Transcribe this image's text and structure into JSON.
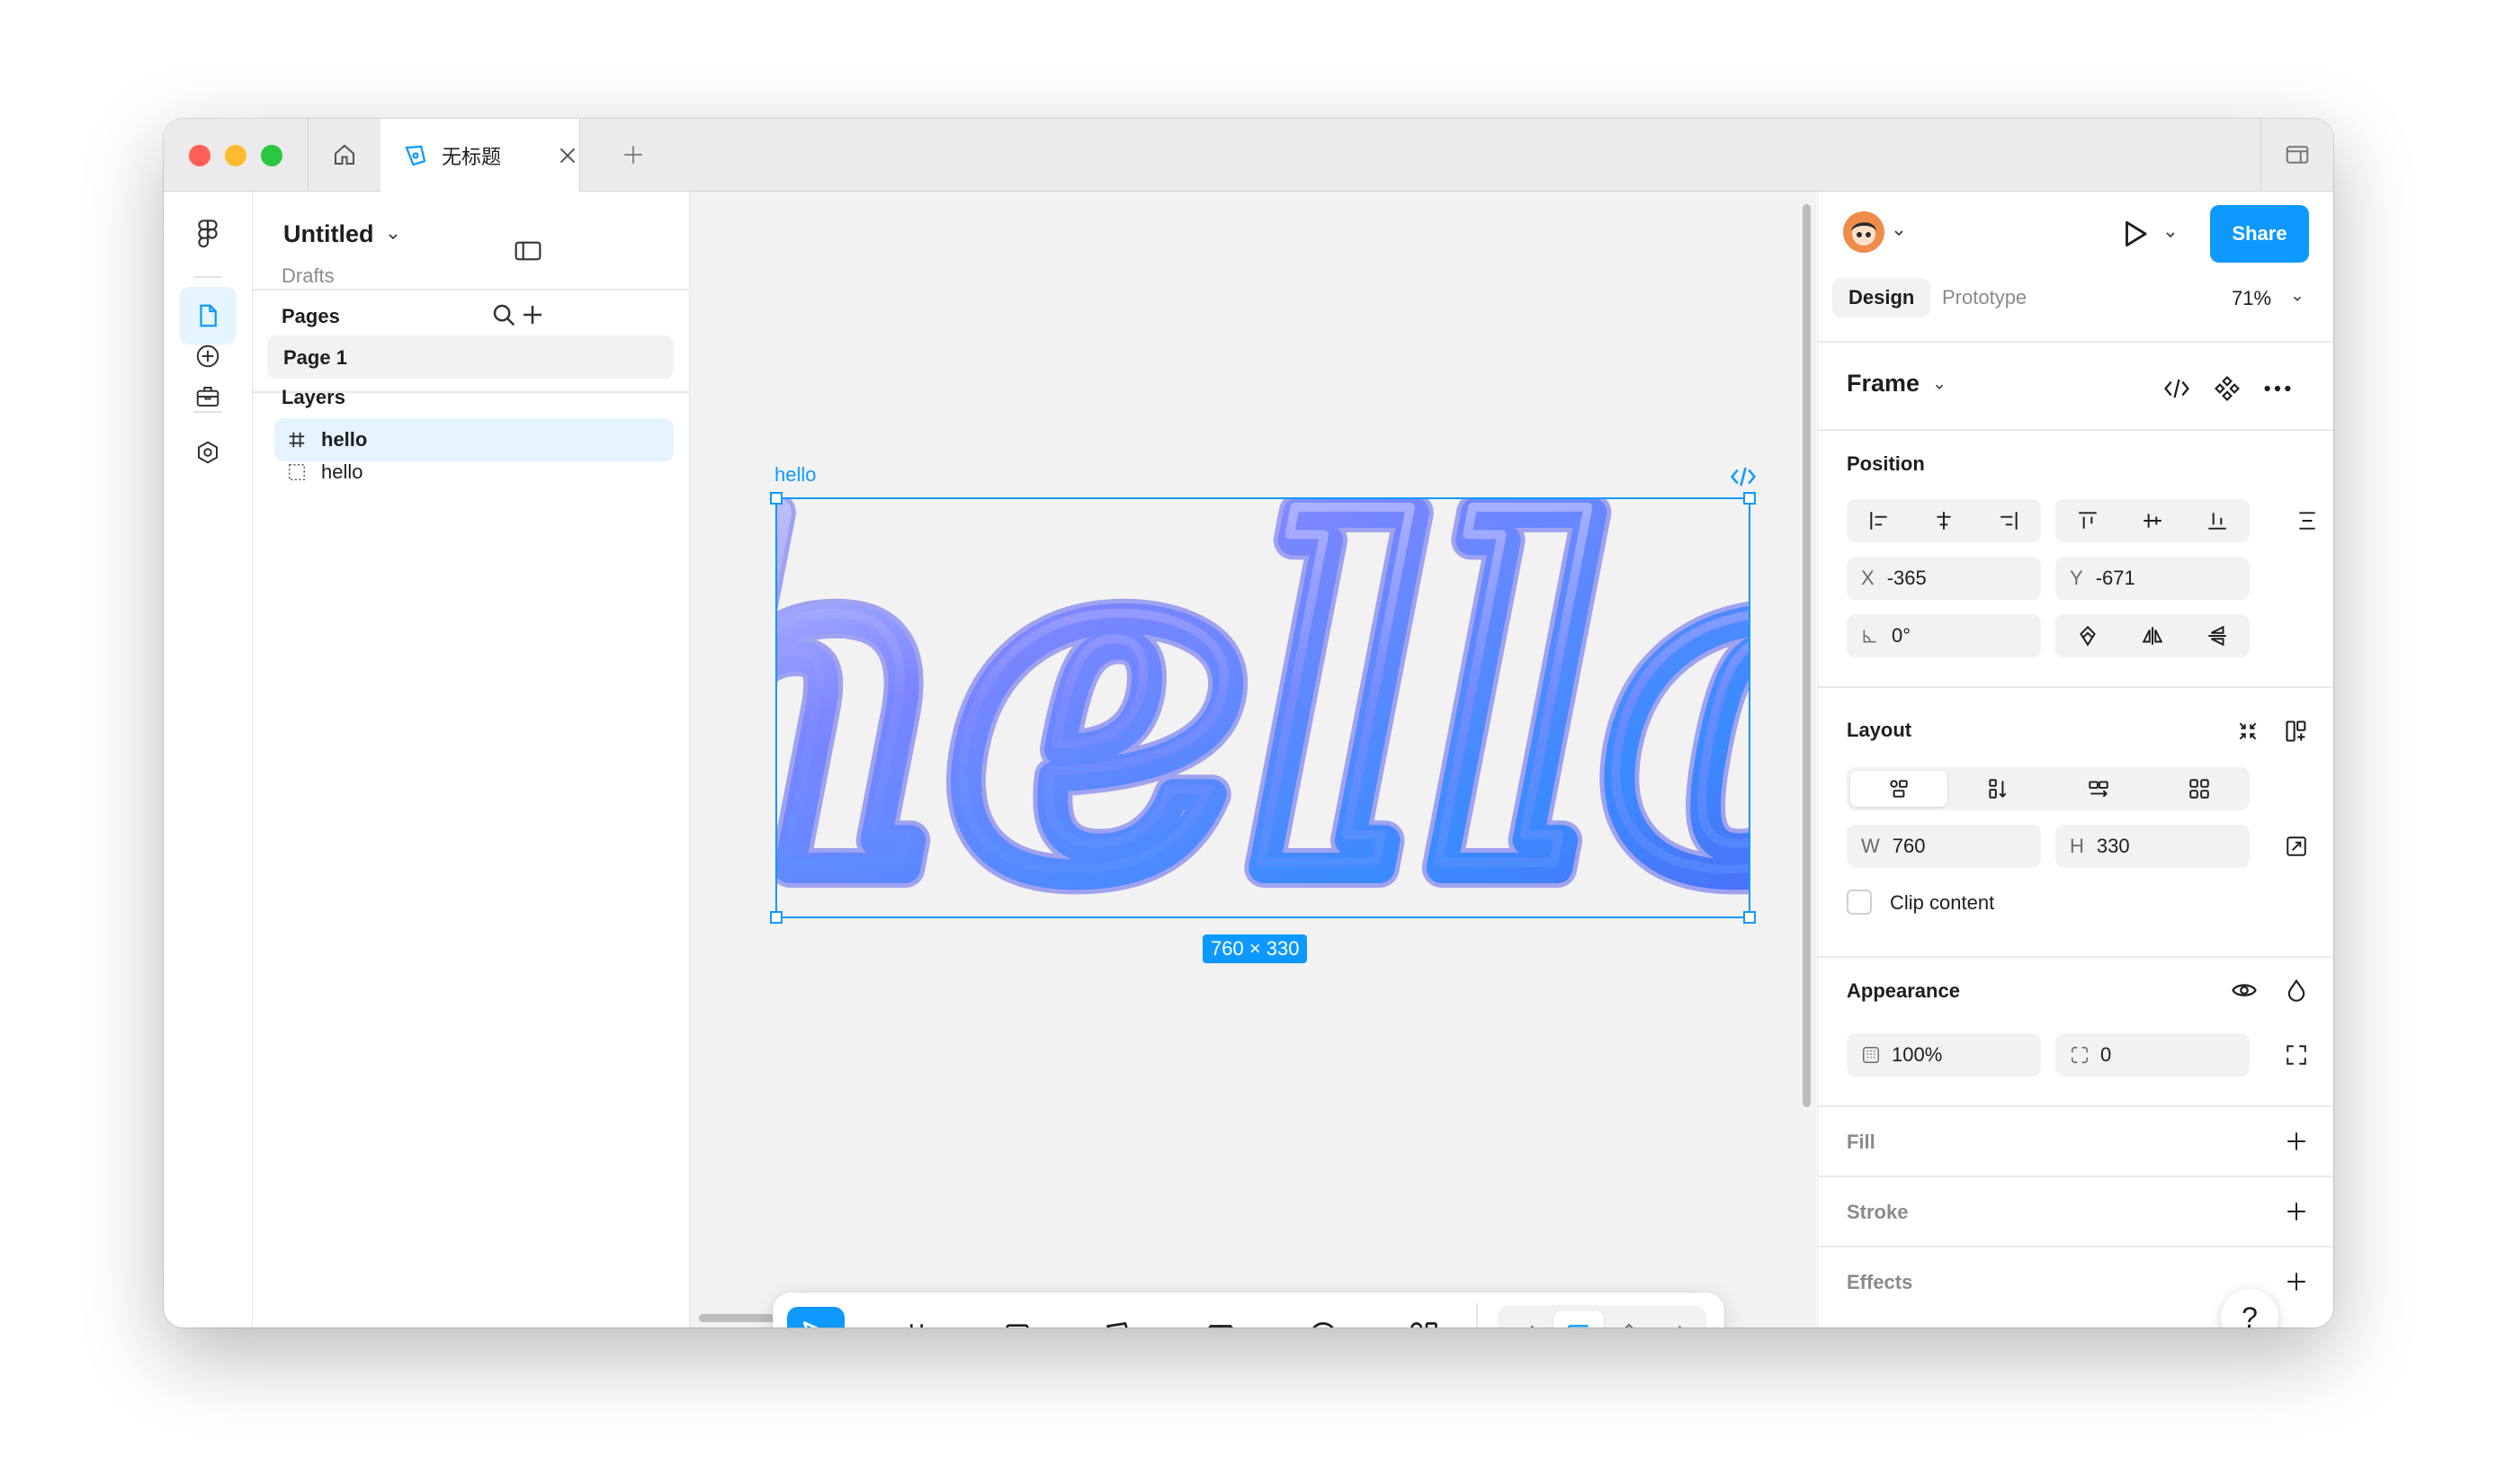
{
  "window": {
    "traffic_lights": {
      "close": "#ff5f57",
      "minimize": "#febc2e",
      "zoom": "#28c840"
    },
    "tab_title": "无标题"
  },
  "rail": {
    "icons": [
      "figma-logo-icon",
      "file-icon",
      "plus-circle-icon",
      "toolbox-icon",
      "hexagon-icon"
    ]
  },
  "left_panel": {
    "file_title": "Untitled",
    "file_location": "Drafts",
    "pages_heading": "Pages",
    "pages": [
      {
        "label": "Page 1"
      }
    ],
    "layers_heading": "Layers",
    "layers": [
      {
        "label": "hello",
        "icon": "frame-hash-icon"
      },
      {
        "label": "hello",
        "icon": "dashed-frame-icon"
      }
    ]
  },
  "canvas": {
    "frame_label": "hello",
    "frame_text": "hello",
    "dimensions_badge": "760 × 330",
    "selection_color": "#0d99ff"
  },
  "toolbar": {
    "tools": [
      "move-tool",
      "frame-tool",
      "rectangle-tool",
      "pen-tool",
      "text-tool",
      "comment-tool",
      "actions-tool"
    ],
    "dev_tools": [
      "draw-mode",
      "design-mode",
      "dev-component",
      "dev-mode"
    ]
  },
  "right_panel": {
    "share_label": "Share",
    "tabs": {
      "design": "Design",
      "prototype": "Prototype"
    },
    "zoom": "71%",
    "frame_title": "Frame",
    "position": {
      "heading": "Position",
      "x_label": "X",
      "x_value": "-365",
      "y_label": "Y",
      "y_value": "-671",
      "rotation_value": "0°"
    },
    "layout": {
      "heading": "Layout",
      "w_label": "W",
      "w_value": "760",
      "h_label": "H",
      "h_value": "330",
      "clip_label": "Clip content"
    },
    "appearance": {
      "heading": "Appearance",
      "opacity_value": "100%",
      "radius_value": "0"
    },
    "fill_heading": "Fill",
    "stroke_heading": "Stroke",
    "effects_heading": "Effects",
    "help_label": "?"
  },
  "colors": {
    "accent": "#0d99ff",
    "canvas_bg": "#f2f2f2"
  }
}
